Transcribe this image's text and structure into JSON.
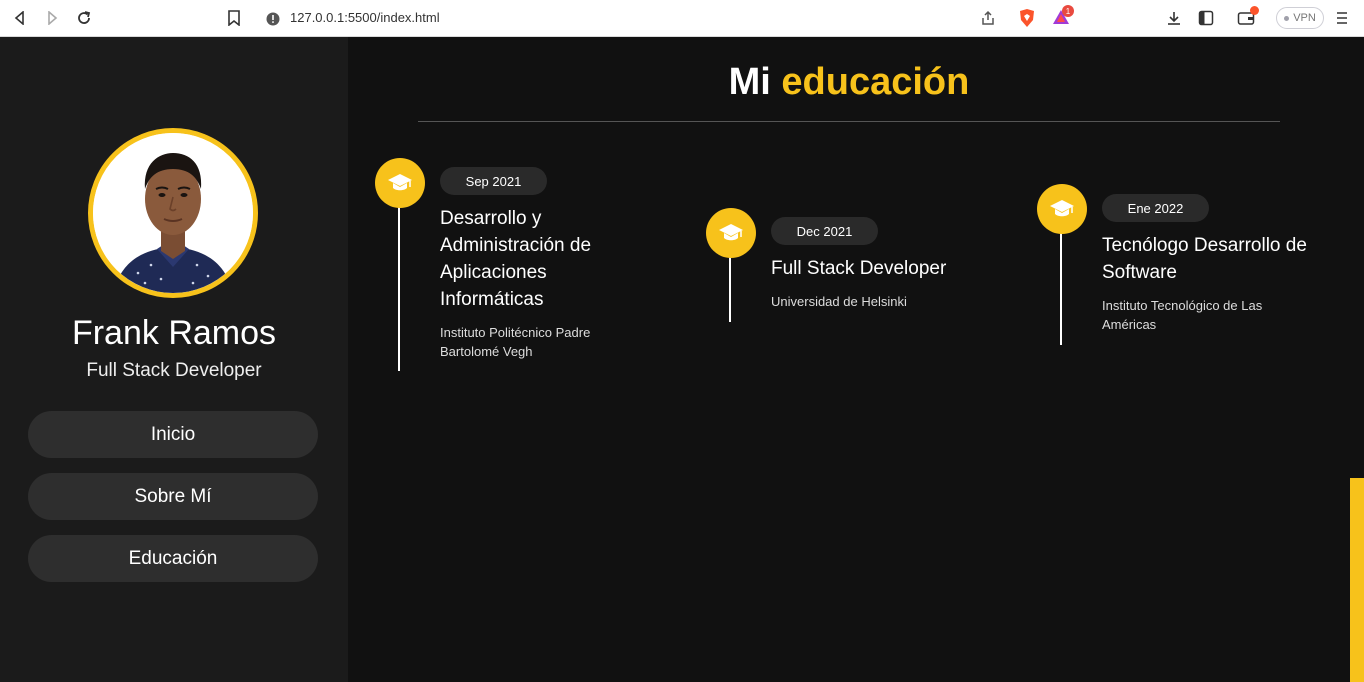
{
  "browser": {
    "url": "127.0.0.1:5500/index.html",
    "vpn_label": "VPN",
    "notification_count": "1"
  },
  "profile": {
    "name": "Frank Ramos",
    "role": "Full Stack Developer"
  },
  "menu": {
    "items": [
      {
        "label": "Inicio"
      },
      {
        "label": "Sobre Mí"
      },
      {
        "label": "Educación"
      }
    ]
  },
  "education": {
    "title_prefix": "Mi",
    "title_accent": "educación",
    "items": [
      {
        "date": "Sep 2021",
        "degree": "Desarrollo y Administración de Aplicaciones Informáticas",
        "school": "Instituto Politécnico Padre Bartolomé Vegh"
      },
      {
        "date": "Dec 2021",
        "degree": "Full Stack Developer",
        "school": "Universidad de Helsinki"
      },
      {
        "date": "Ene 2022",
        "degree": "Tecnólogo Desarrollo de Software",
        "school": "Instituto Tecnológico de Las Américas"
      }
    ]
  },
  "colors": {
    "accent": "#f7c21b",
    "sidebar_bg": "#1b1b1b",
    "main_bg": "#111111",
    "button_bg": "#2e2e2e"
  },
  "icons": {
    "education_icon": "graduation-cap-icon"
  }
}
